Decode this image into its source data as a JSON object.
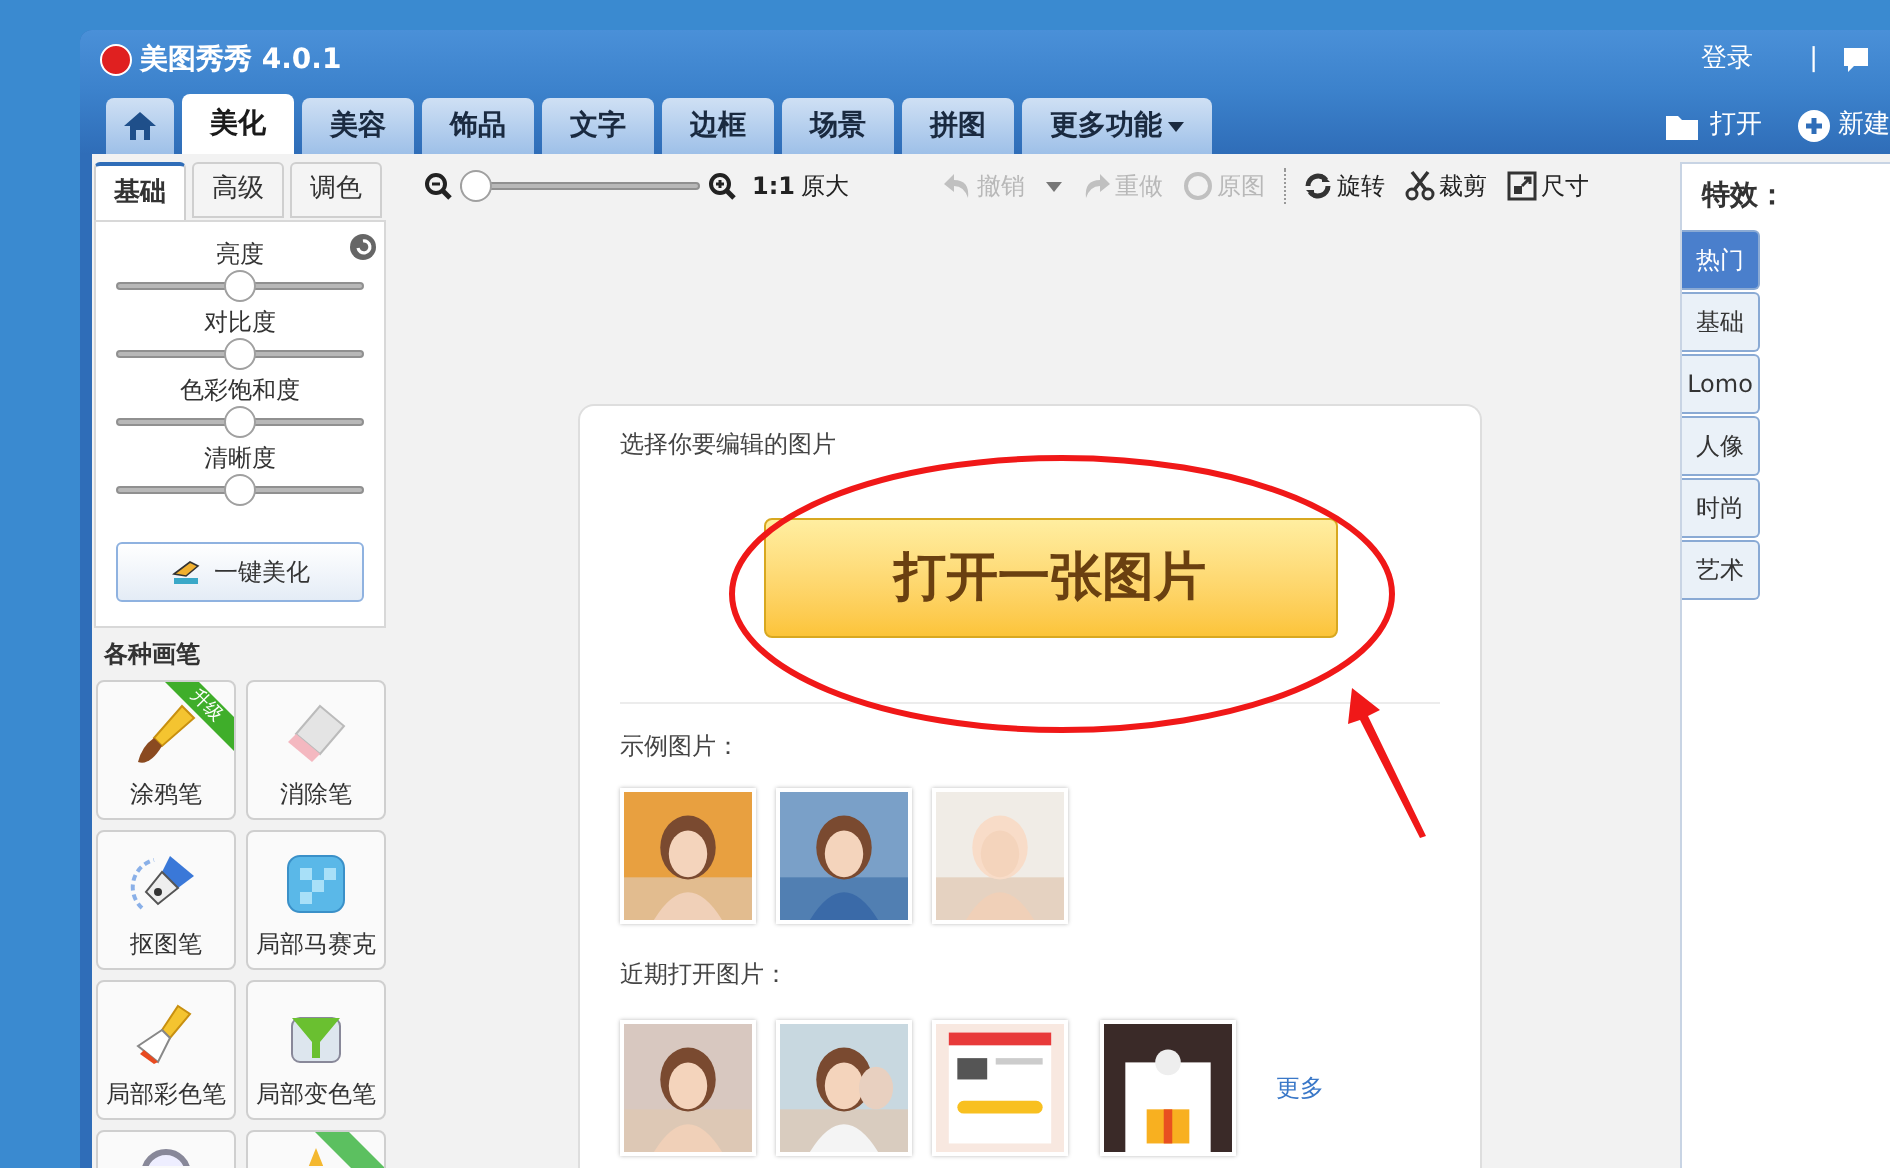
{
  "window": {
    "title": "美图秀秀 4.0.1",
    "login": "登录",
    "separator": "|"
  },
  "main_tabs": [
    {
      "label": "美化",
      "selected": true
    },
    {
      "label": "美容",
      "selected": false
    },
    {
      "label": "饰品",
      "selected": false
    },
    {
      "label": "文字",
      "selected": false
    },
    {
      "label": "边框",
      "selected": false
    },
    {
      "label": "场景",
      "selected": false
    },
    {
      "label": "拼图",
      "selected": false
    },
    {
      "label": "更多功能",
      "selected": false,
      "dropdown": true
    }
  ],
  "header_actions": [
    {
      "kind": "open",
      "label": "打开"
    },
    {
      "kind": "new",
      "label": "新建"
    }
  ],
  "adjust_tabs": [
    {
      "label": "基础",
      "selected": true
    },
    {
      "label": "高级",
      "selected": false
    },
    {
      "label": "调色",
      "selected": false
    }
  ],
  "adjust_sliders": [
    {
      "label": "亮度",
      "level": 0.5
    },
    {
      "label": "对比度",
      "level": 0.5
    },
    {
      "label": "色彩饱和度",
      "level": 0.5
    },
    {
      "label": "清晰度",
      "level": 0.5
    }
  ],
  "auto_button": "一键美化",
  "brushes": {
    "title": "各种画笔",
    "items": [
      {
        "kind": "crayon",
        "label": "涂鸦笔",
        "ribbon": "升级"
      },
      {
        "kind": "eraser",
        "label": "消除笔"
      },
      {
        "kind": "pen",
        "label": "抠图笔"
      },
      {
        "kind": "mosaic",
        "label": "局部马赛克"
      },
      {
        "kind": "brush",
        "label": "局部彩色笔"
      },
      {
        "kind": "funnel",
        "label": "局部变色笔"
      },
      {
        "kind": "magnifier"
      },
      {
        "kind": "star",
        "ribbon_shape": true
      }
    ]
  },
  "toolbar": {
    "zoom": {
      "level": 0
    },
    "zoom_ratio": "1:1",
    "zoom_label": "原大",
    "items": [
      {
        "kind": "undo",
        "label": "撤销",
        "disabled": true,
        "dropdown": true
      },
      {
        "kind": "redo",
        "label": "重做",
        "disabled": true
      },
      {
        "kind": "original",
        "label": "原图",
        "disabled": true
      },
      {
        "kind": "rotate",
        "label": "旋转",
        "disabled": false
      },
      {
        "kind": "crop",
        "label": "裁剪",
        "disabled": false
      },
      {
        "kind": "size",
        "label": "尺寸",
        "disabled": false
      }
    ]
  },
  "start_card": {
    "prompt": "选择你要编辑的图片",
    "open_button": "打开一张图片",
    "samples_title": "示例图片：",
    "recent_title": "近期打开图片：",
    "more_link": "更多"
  },
  "effects": {
    "title": "特效：",
    "tabs": [
      {
        "label": "热门",
        "selected": true
      },
      {
        "label": "基础",
        "selected": false
      },
      {
        "label": "Lomo",
        "selected": false
      },
      {
        "label": "人像",
        "selected": false
      },
      {
        "label": "时尚",
        "selected": false
      },
      {
        "label": "艺术",
        "selected": false
      }
    ]
  }
}
